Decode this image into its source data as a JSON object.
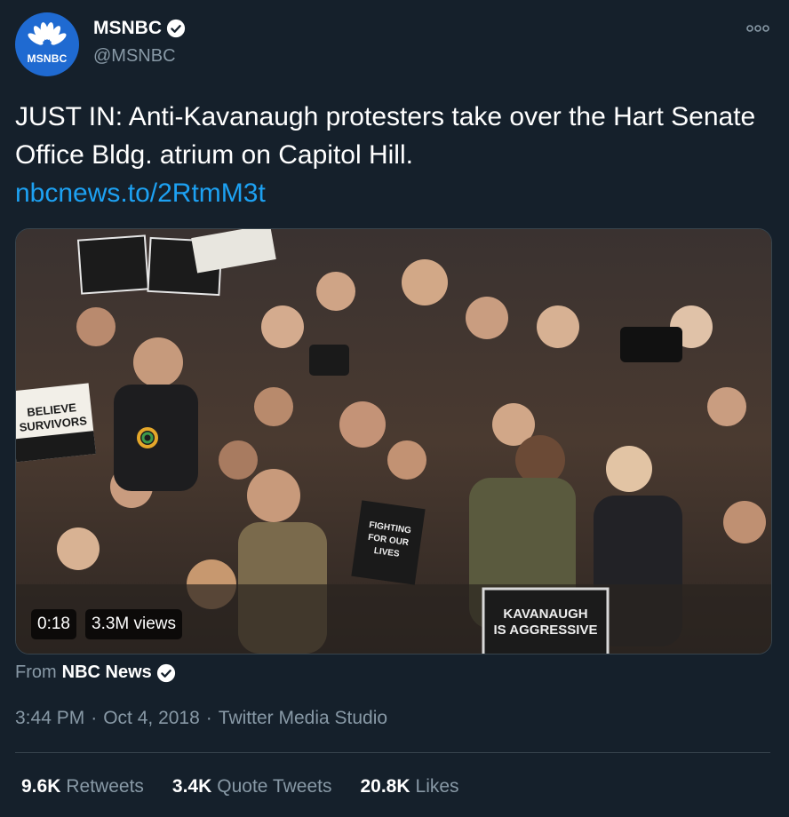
{
  "author": {
    "display_name": "MSNBC",
    "handle": "@MSNBC",
    "avatar_text": "MSNBC",
    "verified": true
  },
  "tweet": {
    "text": "JUST IN: Anti-Kavanaugh protesters take over the Hart Senate Office Bldg. atrium on Capitol Hill.",
    "link": "nbcnews.to/2RtmM3t"
  },
  "media": {
    "duration": "0:18",
    "views": "3.3M views",
    "signs": {
      "believe_survivors": [
        "BELIEVE",
        "SURVIVORS"
      ],
      "fighting": [
        "FIGHTING",
        "FOR OUR LIVES"
      ],
      "kavanaugh": [
        "KAVANAUGH",
        "IS AGGRESSIVE"
      ]
    }
  },
  "source": {
    "prefix": "From",
    "name": "NBC News"
  },
  "meta": {
    "time": "3:44 PM",
    "date": "Oct 4, 2018",
    "client": "Twitter Media Studio",
    "separator": "·"
  },
  "stats": [
    {
      "count": "9.6K",
      "label": "Retweets"
    },
    {
      "count": "3.4K",
      "label": "Quote Tweets"
    },
    {
      "count": "20.8K",
      "label": "Likes"
    }
  ],
  "colors": {
    "background": "#15202b",
    "link": "#1da1f2",
    "muted": "#8899a6",
    "avatar": "#1f6ad1"
  },
  "icons": {
    "verified": "verified-badge-icon",
    "more": "more-dots-icon",
    "logo": "peacock-logo-icon"
  }
}
